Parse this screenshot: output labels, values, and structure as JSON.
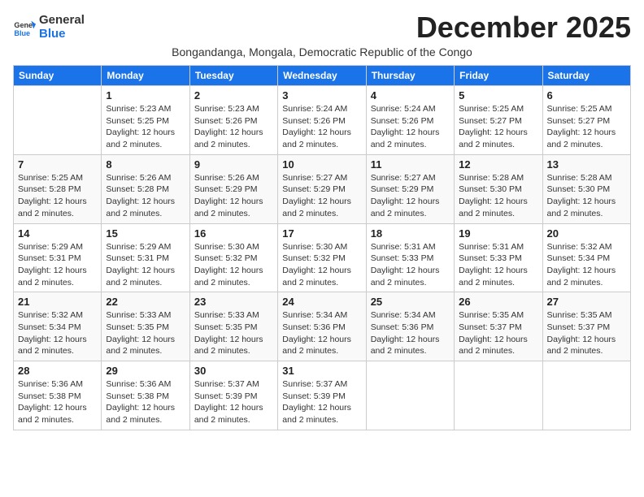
{
  "header": {
    "logo_line1": "General",
    "logo_line2": "Blue",
    "title": "December 2025",
    "subtitle": "Bongandanga, Mongala, Democratic Republic of the Congo"
  },
  "days_of_week": [
    "Sunday",
    "Monday",
    "Tuesday",
    "Wednesday",
    "Thursday",
    "Friday",
    "Saturday"
  ],
  "weeks": [
    [
      {
        "day": "",
        "info": ""
      },
      {
        "day": "1",
        "info": "Sunrise: 5:23 AM\nSunset: 5:25 PM\nDaylight: 12 hours\nand 2 minutes."
      },
      {
        "day": "2",
        "info": "Sunrise: 5:23 AM\nSunset: 5:26 PM\nDaylight: 12 hours\nand 2 minutes."
      },
      {
        "day": "3",
        "info": "Sunrise: 5:24 AM\nSunset: 5:26 PM\nDaylight: 12 hours\nand 2 minutes."
      },
      {
        "day": "4",
        "info": "Sunrise: 5:24 AM\nSunset: 5:26 PM\nDaylight: 12 hours\nand 2 minutes."
      },
      {
        "day": "5",
        "info": "Sunrise: 5:25 AM\nSunset: 5:27 PM\nDaylight: 12 hours\nand 2 minutes."
      },
      {
        "day": "6",
        "info": "Sunrise: 5:25 AM\nSunset: 5:27 PM\nDaylight: 12 hours\nand 2 minutes."
      }
    ],
    [
      {
        "day": "7",
        "info": "Sunrise: 5:25 AM\nSunset: 5:28 PM\nDaylight: 12 hours\nand 2 minutes."
      },
      {
        "day": "8",
        "info": "Sunrise: 5:26 AM\nSunset: 5:28 PM\nDaylight: 12 hours\nand 2 minutes."
      },
      {
        "day": "9",
        "info": "Sunrise: 5:26 AM\nSunset: 5:29 PM\nDaylight: 12 hours\nand 2 minutes."
      },
      {
        "day": "10",
        "info": "Sunrise: 5:27 AM\nSunset: 5:29 PM\nDaylight: 12 hours\nand 2 minutes."
      },
      {
        "day": "11",
        "info": "Sunrise: 5:27 AM\nSunset: 5:29 PM\nDaylight: 12 hours\nand 2 minutes."
      },
      {
        "day": "12",
        "info": "Sunrise: 5:28 AM\nSunset: 5:30 PM\nDaylight: 12 hours\nand 2 minutes."
      },
      {
        "day": "13",
        "info": "Sunrise: 5:28 AM\nSunset: 5:30 PM\nDaylight: 12 hours\nand 2 minutes."
      }
    ],
    [
      {
        "day": "14",
        "info": "Sunrise: 5:29 AM\nSunset: 5:31 PM\nDaylight: 12 hours\nand 2 minutes."
      },
      {
        "day": "15",
        "info": "Sunrise: 5:29 AM\nSunset: 5:31 PM\nDaylight: 12 hours\nand 2 minutes."
      },
      {
        "day": "16",
        "info": "Sunrise: 5:30 AM\nSunset: 5:32 PM\nDaylight: 12 hours\nand 2 minutes."
      },
      {
        "day": "17",
        "info": "Sunrise: 5:30 AM\nSunset: 5:32 PM\nDaylight: 12 hours\nand 2 minutes."
      },
      {
        "day": "18",
        "info": "Sunrise: 5:31 AM\nSunset: 5:33 PM\nDaylight: 12 hours\nand 2 minutes."
      },
      {
        "day": "19",
        "info": "Sunrise: 5:31 AM\nSunset: 5:33 PM\nDaylight: 12 hours\nand 2 minutes."
      },
      {
        "day": "20",
        "info": "Sunrise: 5:32 AM\nSunset: 5:34 PM\nDaylight: 12 hours\nand 2 minutes."
      }
    ],
    [
      {
        "day": "21",
        "info": "Sunrise: 5:32 AM\nSunset: 5:34 PM\nDaylight: 12 hours\nand 2 minutes."
      },
      {
        "day": "22",
        "info": "Sunrise: 5:33 AM\nSunset: 5:35 PM\nDaylight: 12 hours\nand 2 minutes."
      },
      {
        "day": "23",
        "info": "Sunrise: 5:33 AM\nSunset: 5:35 PM\nDaylight: 12 hours\nand 2 minutes."
      },
      {
        "day": "24",
        "info": "Sunrise: 5:34 AM\nSunset: 5:36 PM\nDaylight: 12 hours\nand 2 minutes."
      },
      {
        "day": "25",
        "info": "Sunrise: 5:34 AM\nSunset: 5:36 PM\nDaylight: 12 hours\nand 2 minutes."
      },
      {
        "day": "26",
        "info": "Sunrise: 5:35 AM\nSunset: 5:37 PM\nDaylight: 12 hours\nand 2 minutes."
      },
      {
        "day": "27",
        "info": "Sunrise: 5:35 AM\nSunset: 5:37 PM\nDaylight: 12 hours\nand 2 minutes."
      }
    ],
    [
      {
        "day": "28",
        "info": "Sunrise: 5:36 AM\nSunset: 5:38 PM\nDaylight: 12 hours\nand 2 minutes."
      },
      {
        "day": "29",
        "info": "Sunrise: 5:36 AM\nSunset: 5:38 PM\nDaylight: 12 hours\nand 2 minutes."
      },
      {
        "day": "30",
        "info": "Sunrise: 5:37 AM\nSunset: 5:39 PM\nDaylight: 12 hours\nand 2 minutes."
      },
      {
        "day": "31",
        "info": "Sunrise: 5:37 AM\nSunset: 5:39 PM\nDaylight: 12 hours\nand 2 minutes."
      },
      {
        "day": "",
        "info": ""
      },
      {
        "day": "",
        "info": ""
      },
      {
        "day": "",
        "info": ""
      }
    ]
  ]
}
